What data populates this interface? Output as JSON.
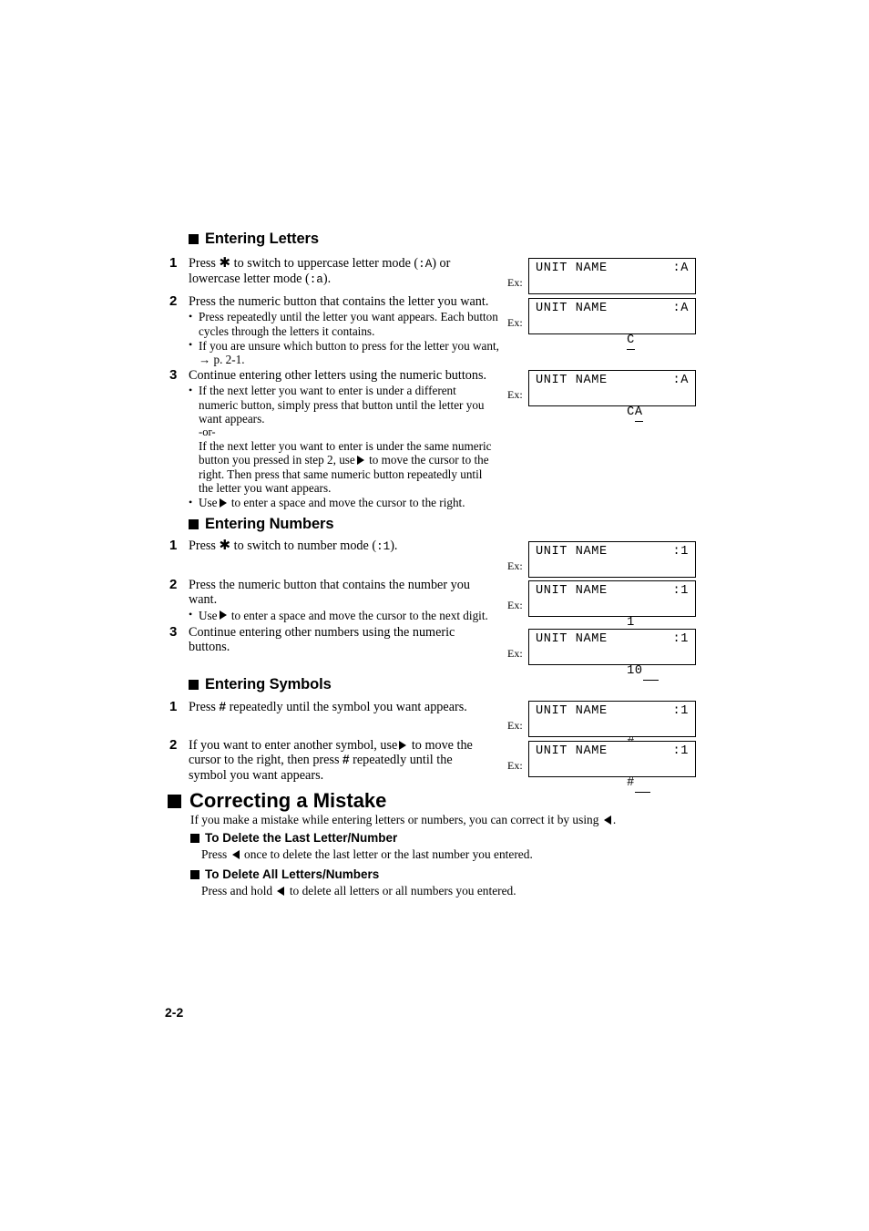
{
  "page": {
    "number": "2-2"
  },
  "sections": {
    "entering_letters": {
      "heading": "Entering Letters",
      "steps": [
        {
          "num": "1",
          "lead_a": "Press",
          "lead_b": "to switch to uppercase letter mode (",
          "mode_upper": ":A",
          "lead_c": ") or",
          "line2": "lowercase letter mode (",
          "mode_lower": ":a",
          "line2_end": ")."
        },
        {
          "num": "2",
          "lead": "Press the numeric button that contains the letter you want.",
          "bullets": [
            "Press repeatedly until the letter you want appears. Each button cycles through the letters it contains.",
            "If you are unsure which button to press for the letter you want, → p. 2-1."
          ]
        },
        {
          "num": "3",
          "lead": "Continue entering other letters using the numeric buttons.",
          "bullet1_a": "If the next letter you want to enter is under a different numeric button, simply press that button until the letter you want appears.",
          "or_text": "-or-",
          "bullet1_b_pre": "If the next letter you want to enter is under the same numeric button you pressed in step 2, use",
          "bullet1_b_post": "to move the cursor to the right. Then press that same numeric button repeatedly until the letter you want appears.",
          "bullet2_pre": "Use",
          "bullet2_post": "to enter a space and move the cursor to the right."
        }
      ],
      "examples": [
        {
          "label": "Ex:",
          "title": "UNIT NAME",
          "mode": ":A",
          "value": "",
          "cursor": true
        },
        {
          "label": "Ex:",
          "title": "UNIT NAME",
          "mode": ":A",
          "value": "C",
          "cursor": false
        },
        {
          "label": "Ex:",
          "title": "UNIT NAME",
          "mode": ":A",
          "value": "CA",
          "cursor": false
        }
      ]
    },
    "entering_numbers": {
      "heading": "Entering Numbers",
      "steps": [
        {
          "num": "1",
          "lead_a": "Press",
          "lead_b": "to switch to number mode (",
          "mode": ":1",
          "lead_c": ")."
        },
        {
          "num": "2",
          "lead": "Press the numeric button that contains the number you want.",
          "bullet_pre": "Use",
          "bullet_post": "to enter a space and move the cursor to the next digit."
        },
        {
          "num": "3",
          "lead": "Continue entering other numbers using the numeric buttons."
        }
      ],
      "examples": [
        {
          "label": "Ex:",
          "title": "UNIT NAME",
          "mode": ":1",
          "value": "",
          "cursor": true
        },
        {
          "label": "Ex:",
          "title": "UNIT NAME",
          "mode": ":1",
          "value": "1",
          "cursor": true
        },
        {
          "label": "Ex:",
          "title": "UNIT NAME",
          "mode": ":1",
          "value": "10",
          "cursor": true
        }
      ]
    },
    "entering_symbols": {
      "heading": "Entering Symbols",
      "steps": [
        {
          "num": "1",
          "lead_a": "Press",
          "lead_b": "repeatedly until the symbol you want appears."
        },
        {
          "num": "2",
          "lead_a": "If you want to enter another symbol, use",
          "lead_b": "to move the cursor to the right, then press",
          "lead_c": "repeatedly until the symbol you want appears."
        }
      ],
      "examples": [
        {
          "label": "Ex:",
          "title": "UNIT NAME",
          "mode": ":1",
          "value": "#",
          "cursor": false
        },
        {
          "label": "Ex:",
          "title": "UNIT NAME",
          "mode": ":1",
          "value": "#",
          "cursor": true
        }
      ]
    },
    "correcting_mistake": {
      "heading": "Correcting a Mistake",
      "intro_pre": "If you make a mistake while entering letters or numbers, you can correct it by using",
      "intro_post": ".",
      "sub1": {
        "heading": "To Delete the Last Letter/Number",
        "text_pre": "Press",
        "text_post": "once to delete the last letter or the last number you entered."
      },
      "sub2": {
        "heading": "To Delete All Letters/Numbers",
        "text_pre": "Press and hold",
        "text_post": "to delete all letters or all numbers you entered."
      }
    }
  }
}
